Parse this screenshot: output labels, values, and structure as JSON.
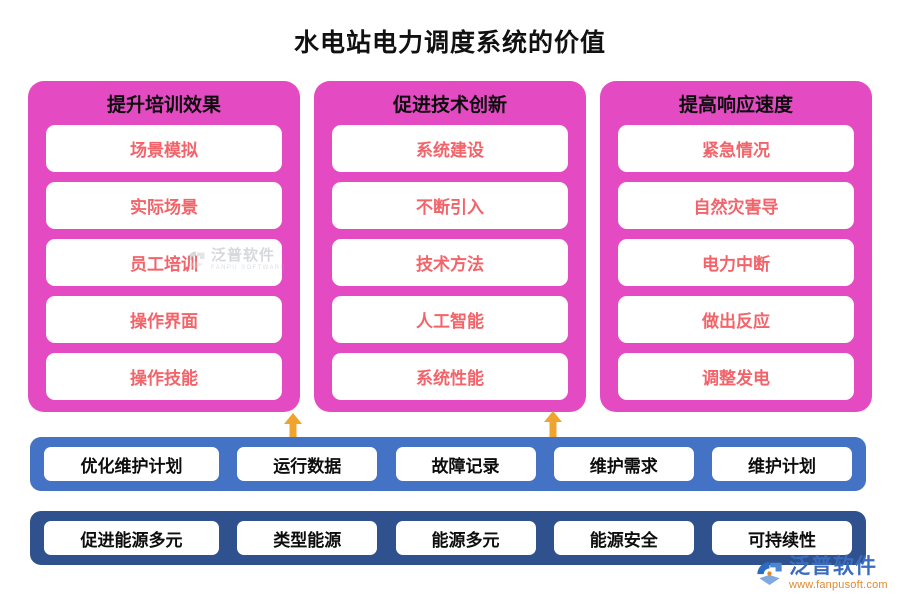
{
  "page": {
    "title": "水电站电力调度系统的价值",
    "background_color": "#FFFFFF"
  },
  "theme": {
    "pink_panel": "#E44BC3",
    "pill_text_red": "#F2646A",
    "blue_bar_light": "#4472C4",
    "blue_bar_dark": "#2F528F",
    "arrow_orange": "#F0A32E",
    "title_text": "#111111"
  },
  "columns": [
    {
      "title": "提升培训效果",
      "items": [
        "场景模拟",
        "实际场景",
        "员工培训",
        "操作界面",
        "操作技能"
      ]
    },
    {
      "title": "促进技术创新",
      "items": [
        "系统建设",
        "不断引入",
        "技术方法",
        "人工智能",
        "系统性能"
      ]
    },
    {
      "title": "提高响应速度",
      "items": [
        "紧急情况",
        "自然灾害导",
        "电力中断",
        "做出反应",
        "调整发电"
      ]
    }
  ],
  "connectors": [
    {
      "name": "double-arrow-left",
      "direction": "up-down",
      "color": "#F0A32E"
    },
    {
      "name": "double-arrow-right",
      "direction": "up-down",
      "color": "#F0A32E"
    }
  ],
  "blue_bars": [
    {
      "color": "#4472C4",
      "items": [
        "优化维护计划",
        "运行数据",
        "故障记录",
        "维护需求",
        "维护计划"
      ]
    },
    {
      "color": "#2F528F",
      "items": [
        "促进能源多元",
        "类型能源",
        "能源多元",
        "能源安全",
        "可持续性"
      ]
    }
  ],
  "watermarks": {
    "center": {
      "brand_cn": "泛普软件",
      "brand_en": "FANPU SOFTWARE"
    },
    "corner": {
      "brand_cn": "泛普软件",
      "url": "www.fanpusoft.com"
    }
  }
}
